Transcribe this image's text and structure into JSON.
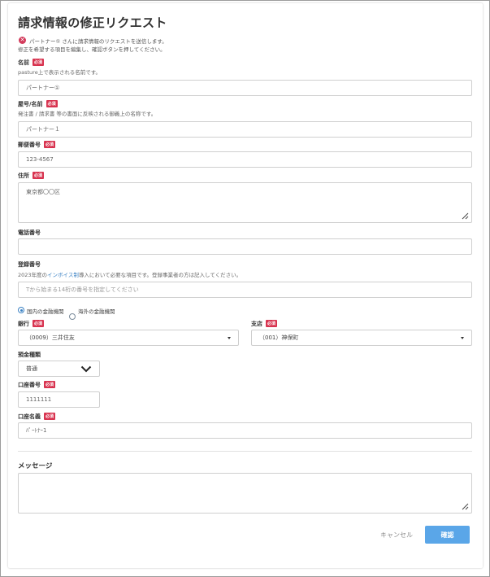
{
  "title": "請求情報の修正リクエスト",
  "notice": {
    "icon": "alert-icon",
    "line1": "パートナー① さんに請求情報のリクエストを送信します。",
    "line2": "修正を希望する項目を編集し、確認ボタンを押してください。"
  },
  "required_badge": "必須",
  "fields": {
    "name": {
      "label": "名前",
      "desc": "pasture上で表示される名前です。",
      "value": "パートナー①"
    },
    "trade_name": {
      "label": "屋号/名前",
      "desc": "発注書 / 請求書 等の書面に反映される御義上の名称です。",
      "value": "パートナー１"
    },
    "postal_code": {
      "label": "郵便番号",
      "value": "123-4567"
    },
    "address": {
      "label": "住所",
      "value": "東京都〇〇区"
    },
    "phone": {
      "label": "電話番号",
      "value": ""
    },
    "registration": {
      "label": "登録番号",
      "desc_before": "2023年度の",
      "desc_link": "インボイス制",
      "desc_after": "導入において必要な項目です。登録事業者の方は記入してください。",
      "placeholder": "Tから始まる14桁の番号を指定してください"
    }
  },
  "bank_type": {
    "options": [
      "国内の金融機関",
      "海外の金融機関"
    ],
    "selected": 0
  },
  "bank": {
    "label": "銀行",
    "value": "（0009）三井住友"
  },
  "branch": {
    "label": "支店",
    "value": "（001）神保町"
  },
  "account_type": {
    "label": "預金種類",
    "value": "普通"
  },
  "account_number": {
    "label": "口座番号",
    "value": "1111111"
  },
  "account_name": {
    "label": "口座名義",
    "value": "ﾊﾟｰﾄﾅｰ1"
  },
  "message": {
    "label": "メッセージ",
    "value": ""
  },
  "buttons": {
    "cancel": "キャンセル",
    "confirm": "確認"
  },
  "colors": {
    "accent": "#5aa6e8",
    "required": "#d8334f",
    "link": "#3b82c4"
  }
}
